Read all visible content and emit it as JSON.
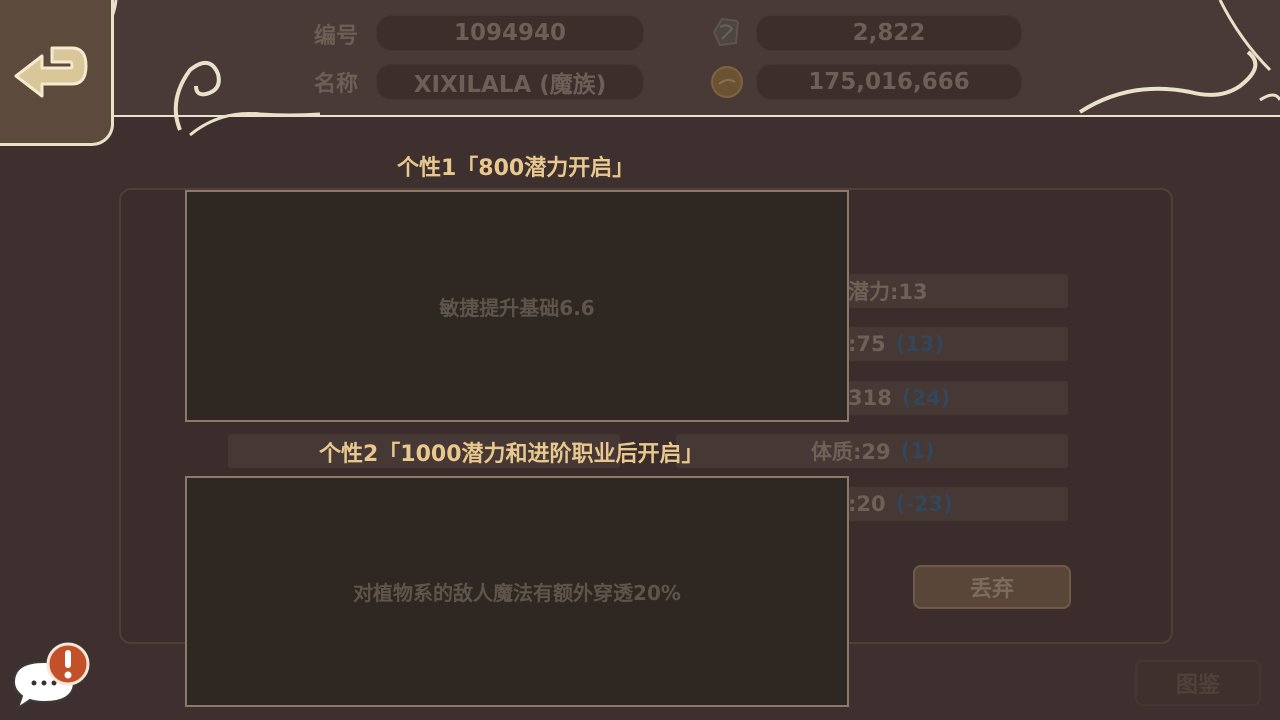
{
  "header": {
    "id_label": "编号",
    "id_value": "1094940",
    "name_label": "名称",
    "name_value": "XIXILALA (魔族)",
    "currency1_icon": "gem-icon",
    "currency1_value": "2,822",
    "currency2_icon": "gold-coin-icon",
    "currency2_value": "175,016,666"
  },
  "back_icon": "return-arrow-icon",
  "background": {
    "stats": [
      {
        "text": "潜力:13",
        "bonus": ""
      },
      {
        "text": ":75",
        "bonus": "(13)"
      },
      {
        "text": "318",
        "bonus": "(24)"
      },
      {
        "text": "体质:29",
        "bonus": "(1)"
      },
      {
        "text": ":20",
        "bonus": "(-23)"
      }
    ],
    "discard_label": "丢弃",
    "codex_label": "图鉴"
  },
  "popup": {
    "trait1_title": "个性1「800潜力开启」",
    "trait1_text": "敏捷提升基础6.6",
    "trait2_title": "个性2「1000潜力和进阶职业后开启」",
    "trait2_text": "对植物系的敌人魔法有额外穿透20%"
  },
  "chat": {
    "icon": "chat-bubble-icon",
    "alert_icon": "exclamation-icon",
    "dots": "···"
  },
  "colors": {
    "title_gold": "#e8c88f",
    "frame_cream": "#e9e2c8",
    "box_border": "#8b7a66"
  }
}
